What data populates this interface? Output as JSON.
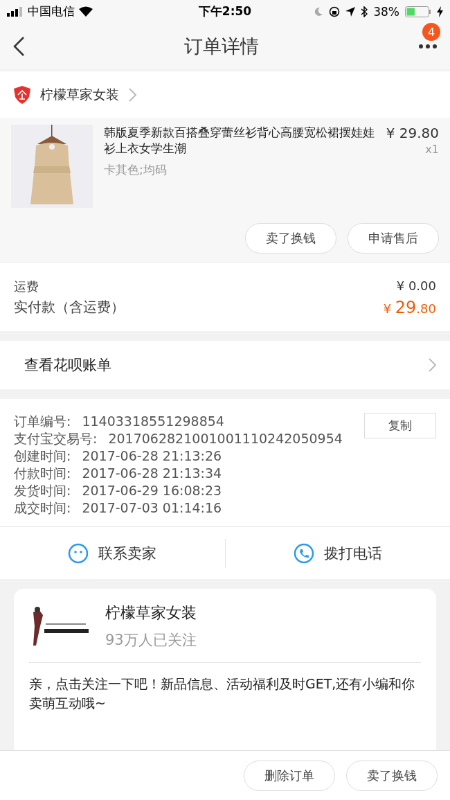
{
  "status_bar": {
    "carrier": "中国电信",
    "time": "下午2:50",
    "battery": "38%"
  },
  "nav": {
    "title": "订单详情",
    "badge": "4"
  },
  "shop": {
    "name": "柠檬草家女装"
  },
  "item": {
    "title": "韩版夏季新款百搭叠穿蕾丝衫背心高腰宽松裙摆娃娃衫上衣女学生潮",
    "sku": "卡其色;均码",
    "price": "¥ 29.80",
    "qty": "x1",
    "buttons": [
      "卖了换钱",
      "申请售后"
    ]
  },
  "fees": {
    "shipping_label": "运费",
    "shipping": "¥ 0.00",
    "paid_label": "实付款（含运费）",
    "paid_currency": "¥ ",
    "paid_int": "29",
    "paid_dec": ".80"
  },
  "huabei": {
    "label": "查看花呗账单"
  },
  "order_info": {
    "copy_button": "复制",
    "rows": [
      {
        "label": "订单编号:",
        "value": "11403318551298854"
      },
      {
        "label": "支付宝交易号:",
        "value": "2017062821001001110242050954"
      },
      {
        "label": "创建时间:",
        "value": "2017-06-28 21:13:26"
      },
      {
        "label": "付款时间:",
        "value": "2017-06-28 21:13:34"
      },
      {
        "label": "发货时间:",
        "value": "2017-06-29 16:08:23"
      },
      {
        "label": "成交时间:",
        "value": "2017-07-03 01:14:16"
      }
    ]
  },
  "contact": [
    {
      "kind": "chat",
      "label": "联系卖家"
    },
    {
      "kind": "phone",
      "label": "拨打电话"
    }
  ],
  "follow_card": {
    "name": "柠檬草家女装",
    "followers": "93万人已关注",
    "message": "亲，点击关注一下吧！新品信息、活动福利及时GET,还有小编和你卖萌互动哦~"
  },
  "bottom_buttons": [
    "删除订单",
    "卖了换钱"
  ]
}
